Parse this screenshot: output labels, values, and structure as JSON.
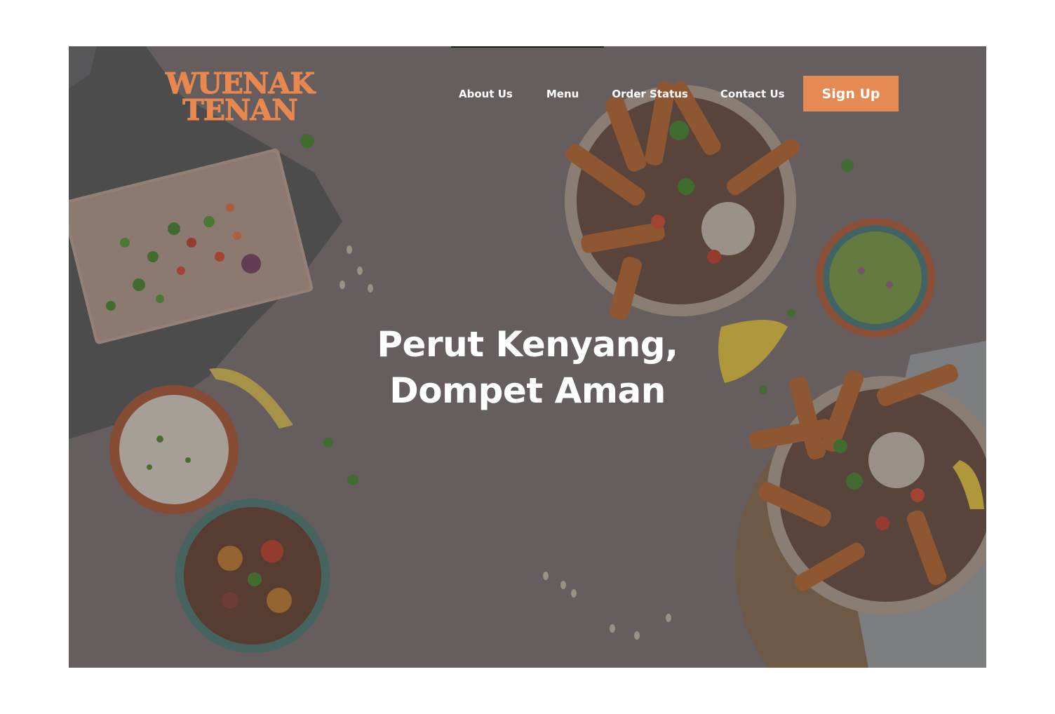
{
  "brand": {
    "line1": "WUENAK",
    "line2": "TENAN",
    "color": "#e8884f"
  },
  "nav": {
    "items": [
      {
        "label": "About Us"
      },
      {
        "label": "Menu"
      },
      {
        "label": "Order Status"
      },
      {
        "label": "Contact Us"
      }
    ],
    "signup_label": "Sign Up",
    "signup_color": "#e68a55"
  },
  "hero": {
    "line1": "Perut Kenyang,",
    "line2": "Dompet Aman",
    "background": "food flat-lay photo with darkened overlay"
  }
}
